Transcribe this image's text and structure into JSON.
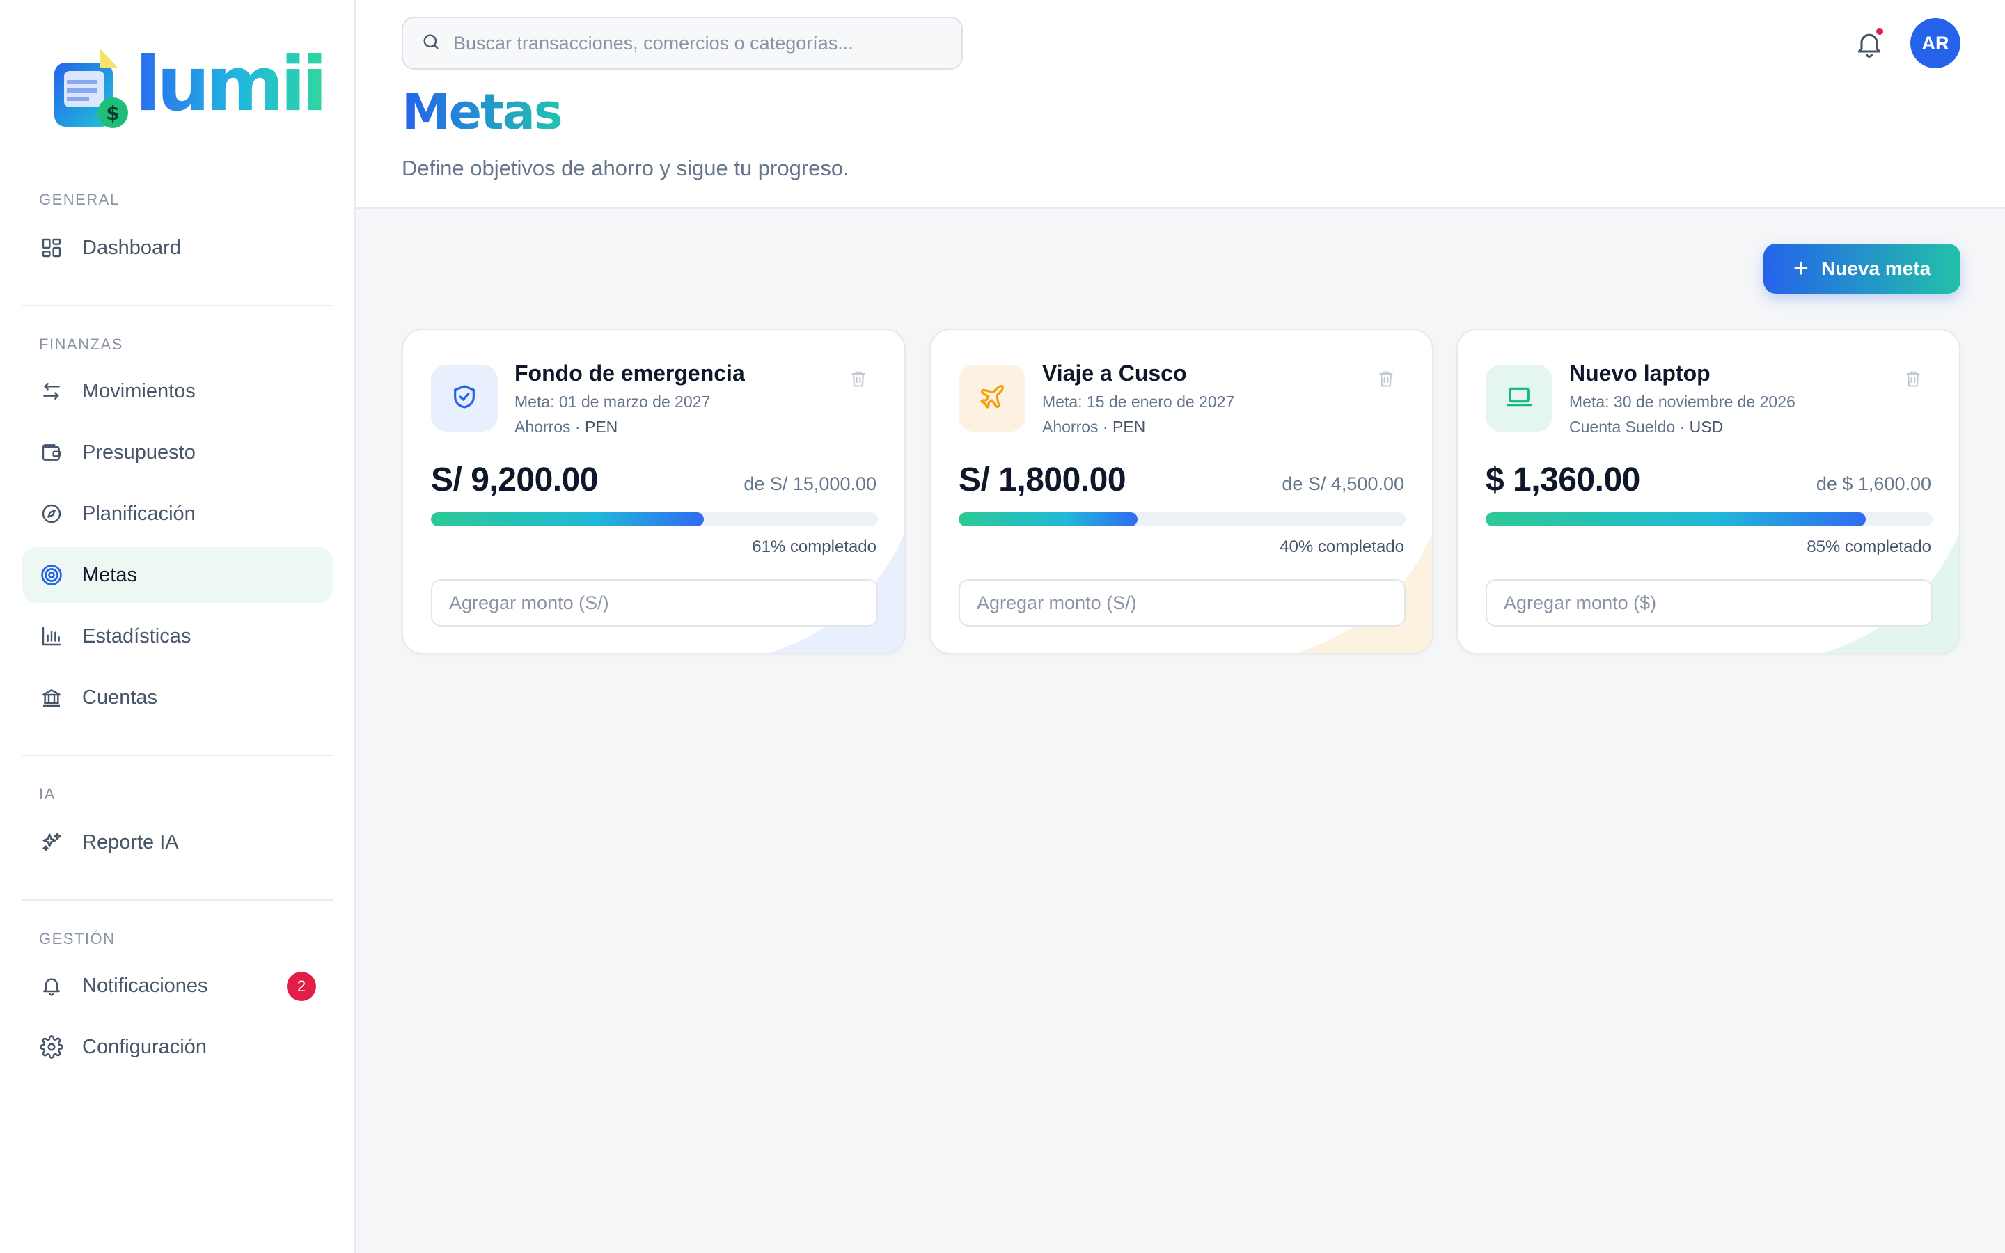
{
  "brand": {
    "name": "lumii"
  },
  "sidebar": {
    "sections": [
      {
        "label": "GENERAL"
      },
      {
        "label": "FINANZAS"
      },
      {
        "label": "IA"
      },
      {
        "label": "GESTIÓN"
      }
    ],
    "items": [
      {
        "label": "Dashboard",
        "icon": "grid-icon",
        "active": false
      },
      {
        "label": "Movimientos",
        "icon": "arrows-swap-icon",
        "active": false
      },
      {
        "label": "Presupuesto",
        "icon": "wallet-icon",
        "active": false
      },
      {
        "label": "Planificación",
        "icon": "compass-icon",
        "active": false
      },
      {
        "label": "Metas",
        "icon": "target-icon",
        "active": true
      },
      {
        "label": "Estadísticas",
        "icon": "bar-chart-icon",
        "active": false
      },
      {
        "label": "Cuentas",
        "icon": "bank-icon",
        "active": false
      },
      {
        "label": "Reporte IA",
        "icon": "sparkles-icon",
        "active": false
      },
      {
        "label": "Notificaciones",
        "icon": "bell-icon",
        "active": false,
        "badge": "2"
      },
      {
        "label": "Configuración",
        "icon": "gear-icon",
        "active": false
      }
    ]
  },
  "header": {
    "search_placeholder": "Buscar transacciones, comercios o categorías...",
    "avatar_initials": "AR",
    "has_unread_notifications": true,
    "title": "Metas",
    "subtitle": "Define objetivos de ahorro y sigue tu progreso."
  },
  "main": {
    "new_goal_label": "Nueva meta",
    "goals": [
      {
        "title": "Fondo de emergencia",
        "date": "Meta: 01 de marzo de 2027",
        "account": "Ahorros",
        "currency": "PEN",
        "amount": "S/ 9,200.00",
        "target": "de S/ 15,000.00",
        "progress": 0.61,
        "progress_label": "61% completado",
        "input_placeholder": "Agregar monto (S/)",
        "icon": "shield-check-icon",
        "accent": "#2563eb"
      },
      {
        "title": "Viaje a Cusco",
        "date": "Meta: 15 de enero de 2027",
        "account": "Ahorros",
        "currency": "PEN",
        "amount": "S/ 1,800.00",
        "target": "de S/ 4,500.00",
        "progress": 0.4,
        "progress_label": "40% completado",
        "input_placeholder": "Agregar monto (S/)",
        "icon": "plane-icon",
        "accent": "#f59e0b"
      },
      {
        "title": "Nuevo laptop",
        "date": "Meta: 30 de noviembre de 2026",
        "account": "Cuenta Sueldo",
        "currency": "USD",
        "amount": "$ 1,360.00",
        "target": "de $ 1,600.00",
        "progress": 0.85,
        "progress_label": "85% completado",
        "input_placeholder": "Agregar monto ($)",
        "icon": "laptop-icon",
        "accent": "#10b981"
      }
    ]
  },
  "colors": {
    "primary": "#2563eb",
    "teal": "#22c1a8",
    "danger": "#e11d48",
    "active_bg": "#edf8f3"
  }
}
